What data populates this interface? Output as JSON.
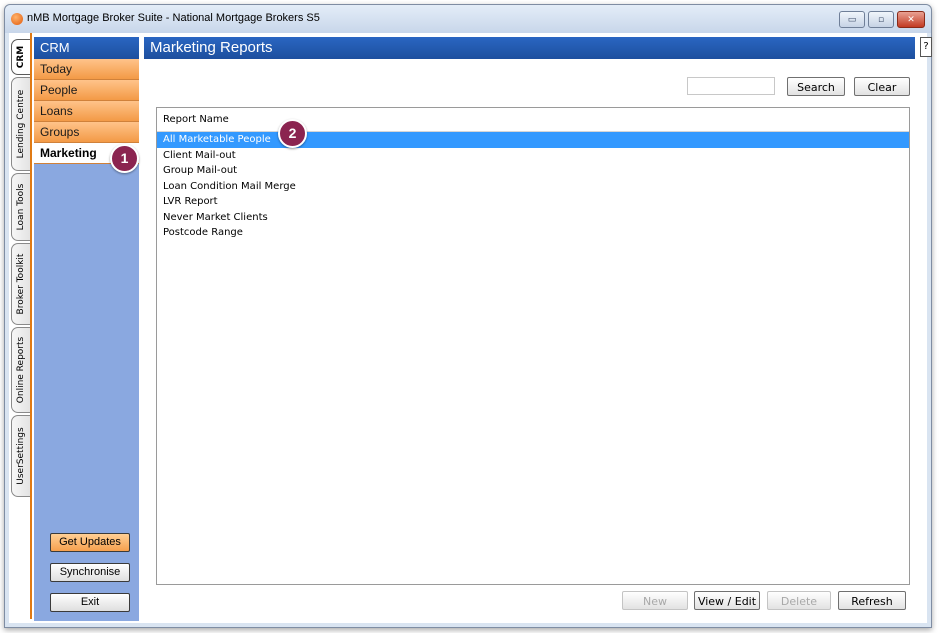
{
  "window": {
    "title": "nMB Mortgage Broker Suite - National Mortgage Brokers S5",
    "controls": {
      "minimize": "▭",
      "maximize": "▫",
      "close": "✕"
    }
  },
  "vertical_tabs": [
    {
      "label": "CRM",
      "active": true
    },
    {
      "label": "Lending Centre",
      "active": false
    },
    {
      "label": "Loan Tools",
      "active": false
    },
    {
      "label": "Broker Toolkit",
      "active": false
    },
    {
      "label": "Online Reports",
      "active": false
    },
    {
      "label": "UserSettings",
      "active": false
    }
  ],
  "sidebar": {
    "header": "CRM",
    "items": [
      {
        "label": "Today",
        "active": false
      },
      {
        "label": "People",
        "active": false
      },
      {
        "label": "Loans",
        "active": false
      },
      {
        "label": "Groups",
        "active": false
      },
      {
        "label": "Marketing",
        "active": true
      }
    ],
    "buttons": {
      "get_updates": "Get Updates",
      "synchronise": "Synchronise",
      "exit": "Exit"
    }
  },
  "main": {
    "header": "Marketing Reports",
    "help": "?",
    "search": {
      "value": "",
      "placeholder": "",
      "search_label": "Search",
      "clear_label": "Clear"
    },
    "list": {
      "column_header": "Report Name",
      "rows": [
        {
          "label": "All Marketable People",
          "selected": true
        },
        {
          "label": "Client Mail-out",
          "selected": false
        },
        {
          "label": "Group Mail-out",
          "selected": false
        },
        {
          "label": "Loan Condition Mail Merge",
          "selected": false
        },
        {
          "label": "LVR Report",
          "selected": false
        },
        {
          "label": "Never Market Clients",
          "selected": false
        },
        {
          "label": "Postcode Range",
          "selected": false
        }
      ]
    },
    "footer_buttons": {
      "new": "New",
      "view_edit": "View / Edit",
      "delete": "Delete",
      "refresh": "Refresh"
    }
  },
  "callouts": {
    "one": "1",
    "two": "2"
  },
  "colors": {
    "header_blue": "#1d4f9e",
    "sidebar_blue": "#8aa8e0",
    "menu_orange": "#f39a46",
    "selection_blue": "#3399ff",
    "callout": "#8b2450"
  }
}
